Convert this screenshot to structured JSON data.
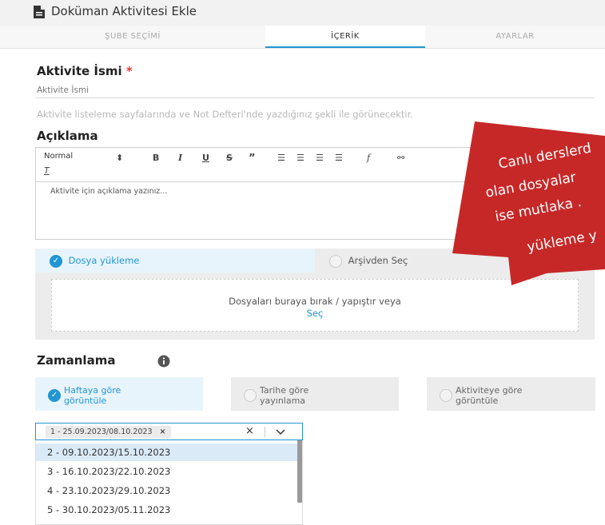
{
  "header": {
    "title": "Doküman Aktivitesi Ekle"
  },
  "tabs": [
    {
      "label": "ŞUBE SEÇİMİ"
    },
    {
      "label": "İÇERİK"
    },
    {
      "label": "AYARLAR"
    }
  ],
  "activity_name": {
    "label": "Aktivite İsmi",
    "required_mark": "*",
    "placeholder": "Aktivite İsmi",
    "hint": "Aktivite listeleme sayfalarında ve Not Defteri'nde yazdığınız şekli ile görünecektir."
  },
  "description": {
    "label": "Açıklama",
    "format_select": "Normal",
    "placeholder": "Aktivite için açıklama yazınız..."
  },
  "upload": {
    "tab_upload": "Dosya yükleme",
    "tab_archive": "Arşivden Seç",
    "drop_text": "Dosyaları buraya bırak / yapıştır veya",
    "select_link": "Seç"
  },
  "scheduling": {
    "label": "Zamanlama",
    "options": [
      {
        "line1": "Haftaya göre",
        "line2": "görüntüle"
      },
      {
        "line1": "Tarihe göre",
        "line2": "yayınlama"
      },
      {
        "line1": "Aktiviteye göre",
        "line2": "görüntüle"
      }
    ],
    "selected_week": "1 - 25.09.2023/08.10.2023",
    "week_options": [
      "2 - 09.10.2023/15.10.2023",
      "3 - 16.10.2023/22.10.2023",
      "4 - 23.10.2023/29.10.2023",
      "5 - 30.10.2023/05.11.2023"
    ]
  },
  "callout": {
    "line1": "Canlı derslerd",
    "line2": "olan dosyalar",
    "line3": "ise mutlaka .",
    "line4": "yükleme y"
  },
  "colors": {
    "accent": "#2196d3",
    "callout": "#c62828"
  }
}
